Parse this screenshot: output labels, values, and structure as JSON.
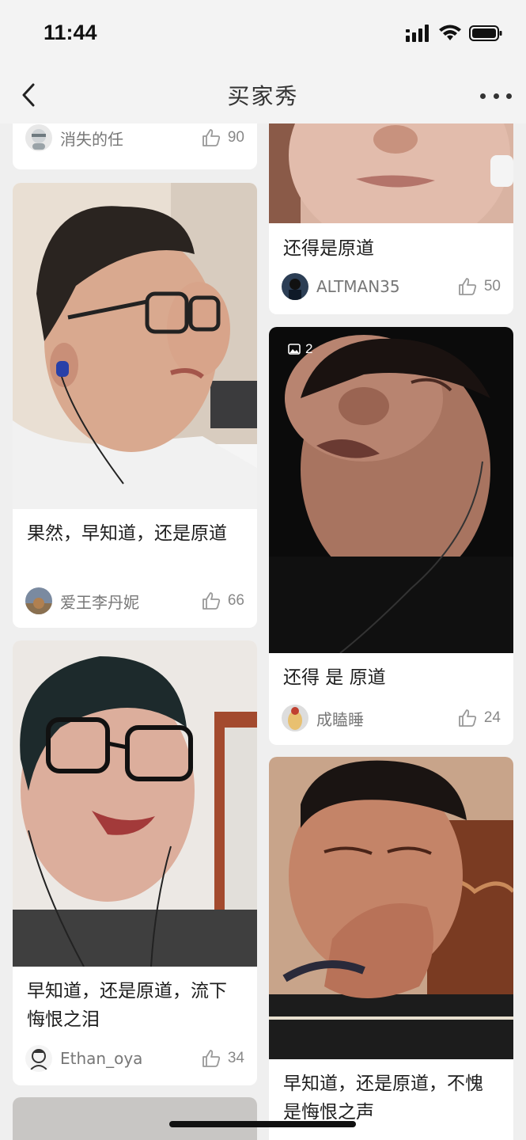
{
  "status_bar": {
    "time": "11:44"
  },
  "nav": {
    "title": "买家秀"
  },
  "colors": {
    "background": "#efefef",
    "card": "#ffffff",
    "text": "#1e1e1e",
    "muted": "#777777"
  },
  "cards": [
    {
      "caption": "",
      "username": "消失的任",
      "likes": "90",
      "photo": "portrait-partial"
    },
    {
      "caption": "果然，早知道，还是原道",
      "username": "爱王李丹妮",
      "likes": "66",
      "photo": "man-glasses-pout"
    },
    {
      "caption": "早知道，还是原道，流下悔恨之泪",
      "username": "Ethan_oya",
      "likes": "34",
      "photo": "man-glasses-crying"
    },
    {
      "caption": "还得是原道",
      "username": "ALTMAN35",
      "likes": "50",
      "photo": "chin-closeup"
    },
    {
      "caption": "还得 是 原道",
      "username": "成瞌睡",
      "likes": "24",
      "photo": "man-sleeping",
      "image_count": "2"
    },
    {
      "caption": "早知道，还是原道，不愧是悔恨之声",
      "username": "",
      "likes": "",
      "photo": "man-covering-mouth"
    }
  ]
}
